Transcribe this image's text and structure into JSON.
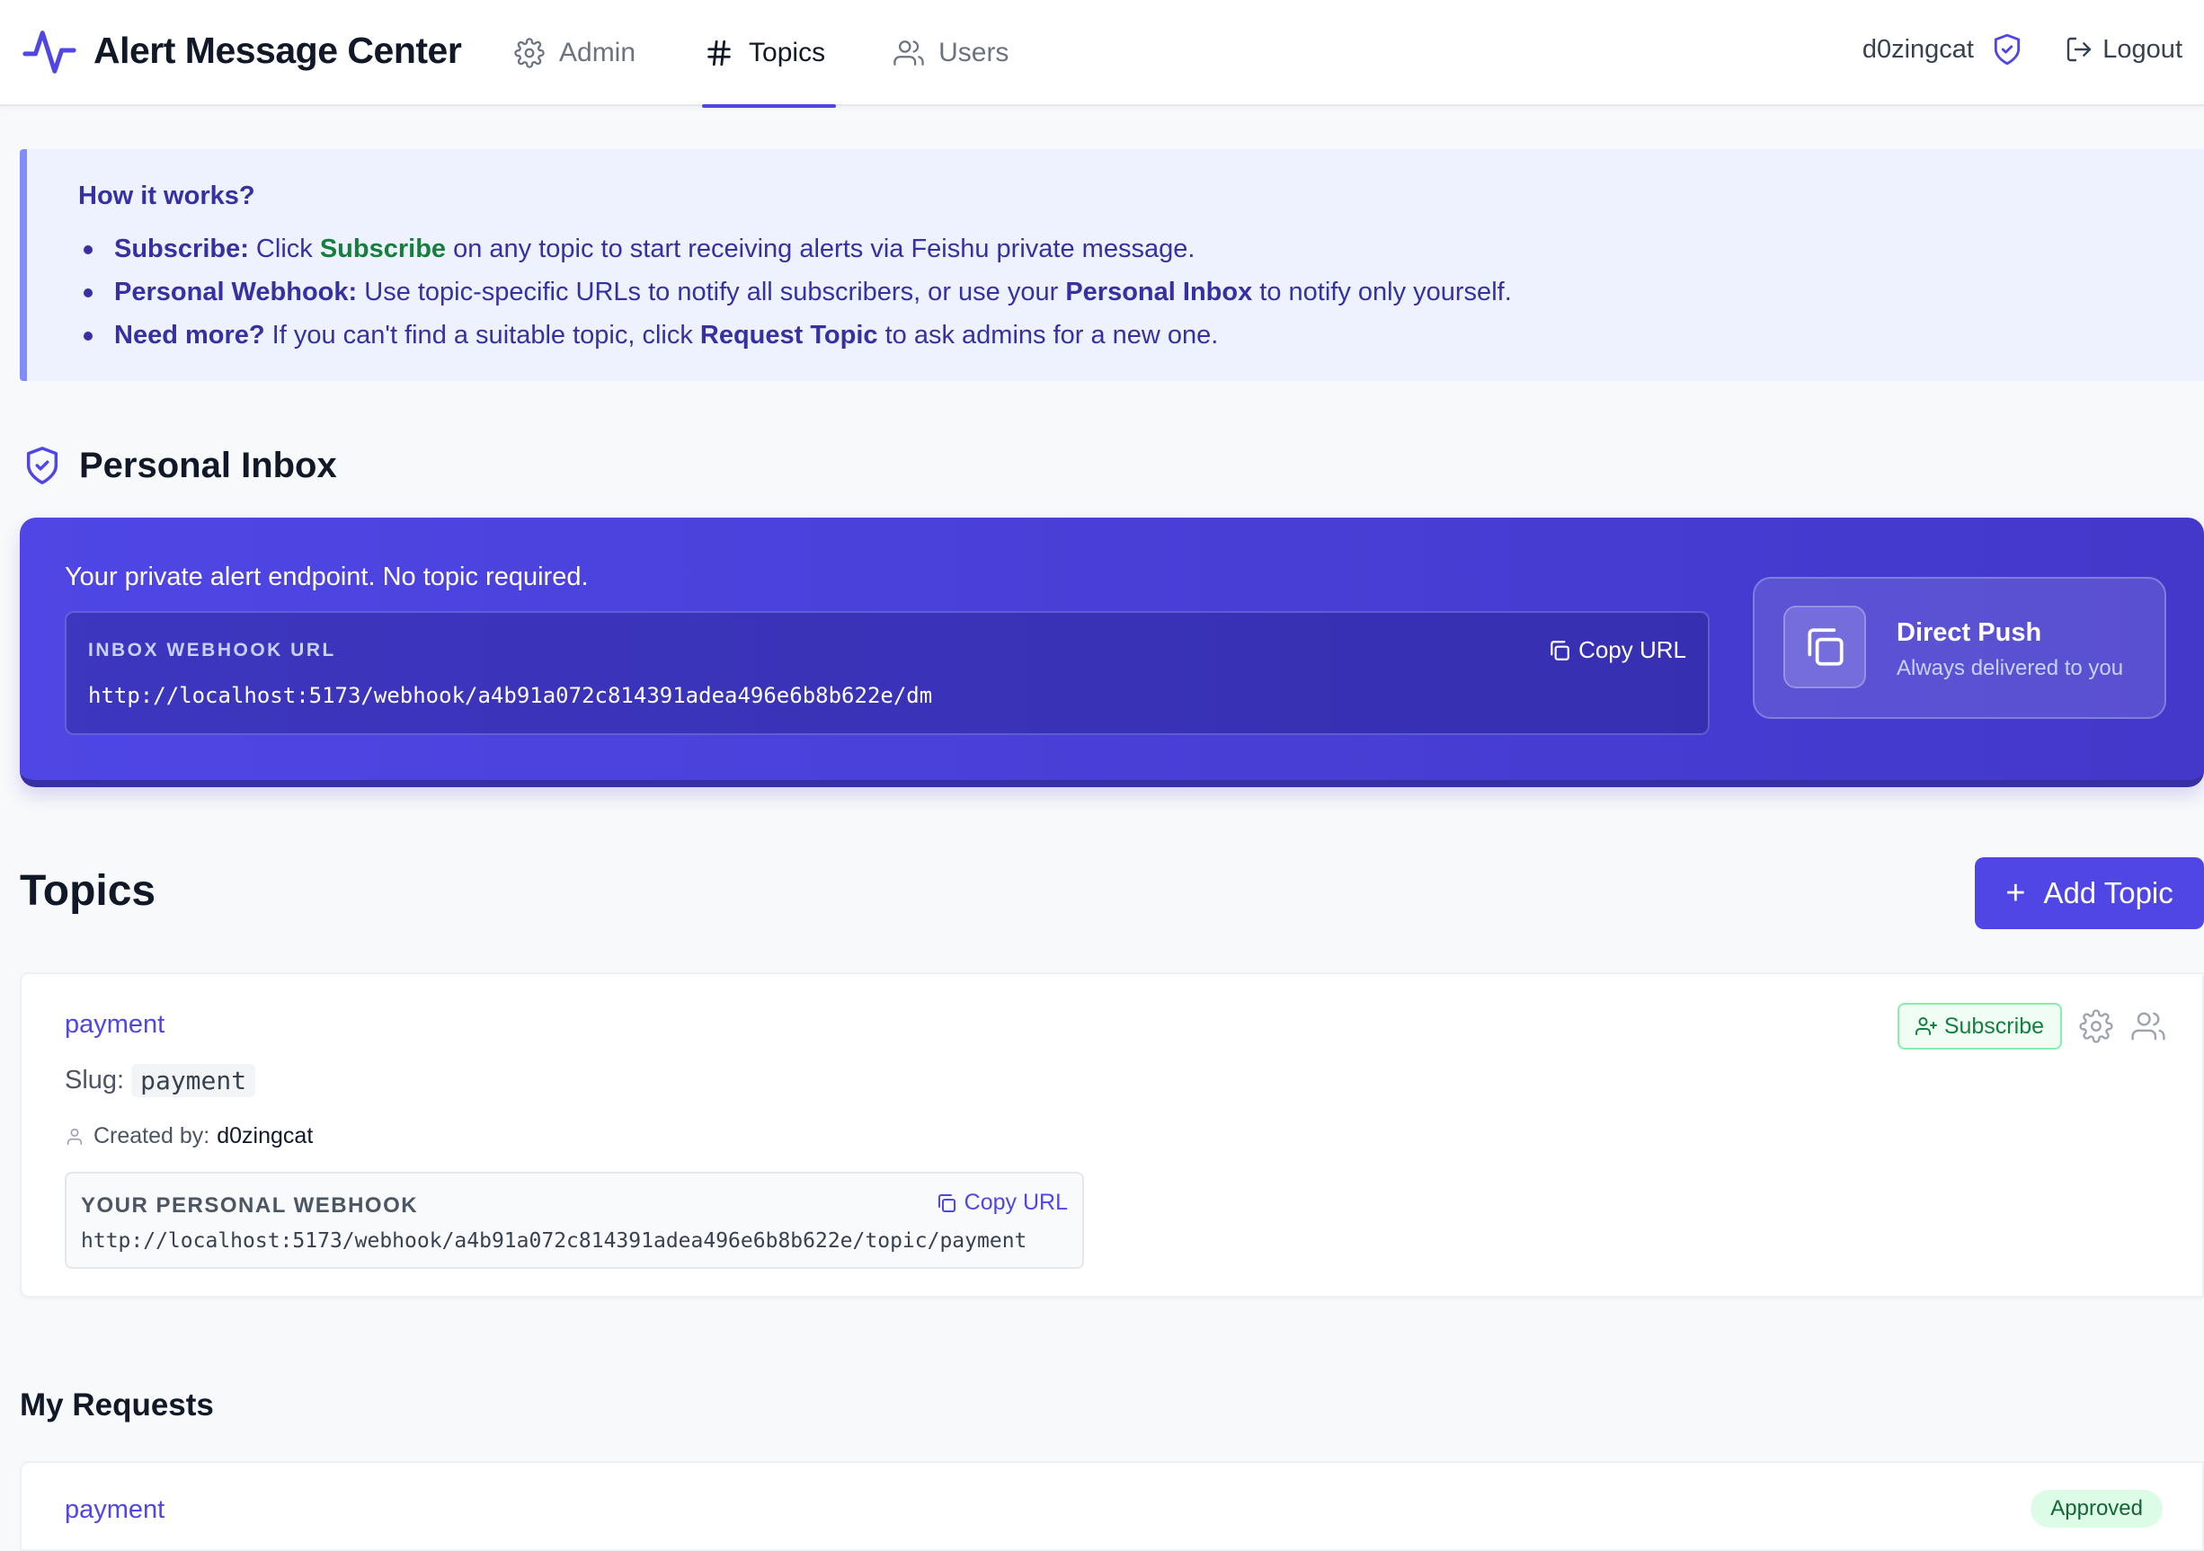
{
  "header": {
    "app_title": "Alert Message Center",
    "nav": [
      {
        "label": "Admin",
        "icon": "gear-icon",
        "active": false
      },
      {
        "label": "Topics",
        "icon": "hash-icon",
        "active": true
      },
      {
        "label": "Users",
        "icon": "users-icon",
        "active": false
      }
    ],
    "username": "d0zingcat",
    "logout_label": "Logout"
  },
  "info": {
    "title": "How it works?",
    "items": [
      {
        "lead": "Subscribe:",
        "pre": " Click ",
        "emph": "Subscribe",
        "post": " on any topic to start receiving alerts via Feishu private message."
      },
      {
        "lead": "Personal Webhook:",
        "pre": " Use topic-specific URLs to notify all subscribers, or use your ",
        "emph": "Personal Inbox",
        "post": " to notify only yourself."
      },
      {
        "lead": "Need more?",
        "pre": " If you can't find a suitable topic, click ",
        "emph": "Request Topic",
        "post": " to ask admins for a new one."
      }
    ]
  },
  "inbox": {
    "heading": "Personal Inbox",
    "description": "Your private alert endpoint. No topic required.",
    "url_label": "INBOX WEBHOOK URL",
    "url": "http://localhost:5173/webhook/a4b91a072c814391adea496e6b8b622e/dm",
    "copy_label": "Copy URL",
    "push_title": "Direct Push",
    "push_subtitle": "Always delivered to you"
  },
  "topics": {
    "heading": "Topics",
    "add_label": "Add Topic",
    "items": [
      {
        "name": "payment",
        "slug_label": "Slug:",
        "slug": "payment",
        "created_by_label": "Created by:",
        "created_by": "d0zingcat",
        "subscribe_label": "Subscribe",
        "webhook_label": "YOUR PERSONAL WEBHOOK",
        "webhook_url": "http://localhost:5173/webhook/a4b91a072c814391adea496e6b8b622e/topic/payment",
        "copy_label": "Copy URL"
      }
    ]
  },
  "requests": {
    "heading": "My Requests",
    "items": [
      {
        "name": "payment",
        "status": "Approved"
      }
    ]
  },
  "colors": {
    "accent": "#4f46e5",
    "success": "#15803d",
    "info_bg": "#eef2ff"
  }
}
